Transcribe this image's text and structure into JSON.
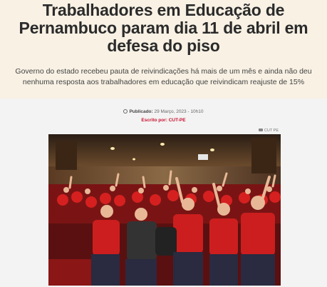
{
  "article": {
    "headline": "Trabalhadores em Educação de Pernambuco param dia 11 de abril em defesa do piso",
    "subtitle": "Governo do estado recebeu pauta de reivindicações há mais de um mês e ainda não deu nenhuma resposta aos trabalhadores em educação que reivindicam reajuste de 15%",
    "published_label": "Publicado:",
    "published_date": "29 Março, 2023 - 10h10",
    "author_label": "Escrito por:",
    "author_name": "CUT-PE",
    "photo_credit": "CUT PE"
  },
  "icons": {
    "published": "clock-icon",
    "photo_credit": "camera-icon"
  },
  "colors": {
    "header_background": "#f8f1e4",
    "author_accent": "#c8102e",
    "body_background": "#f3f3f3"
  }
}
